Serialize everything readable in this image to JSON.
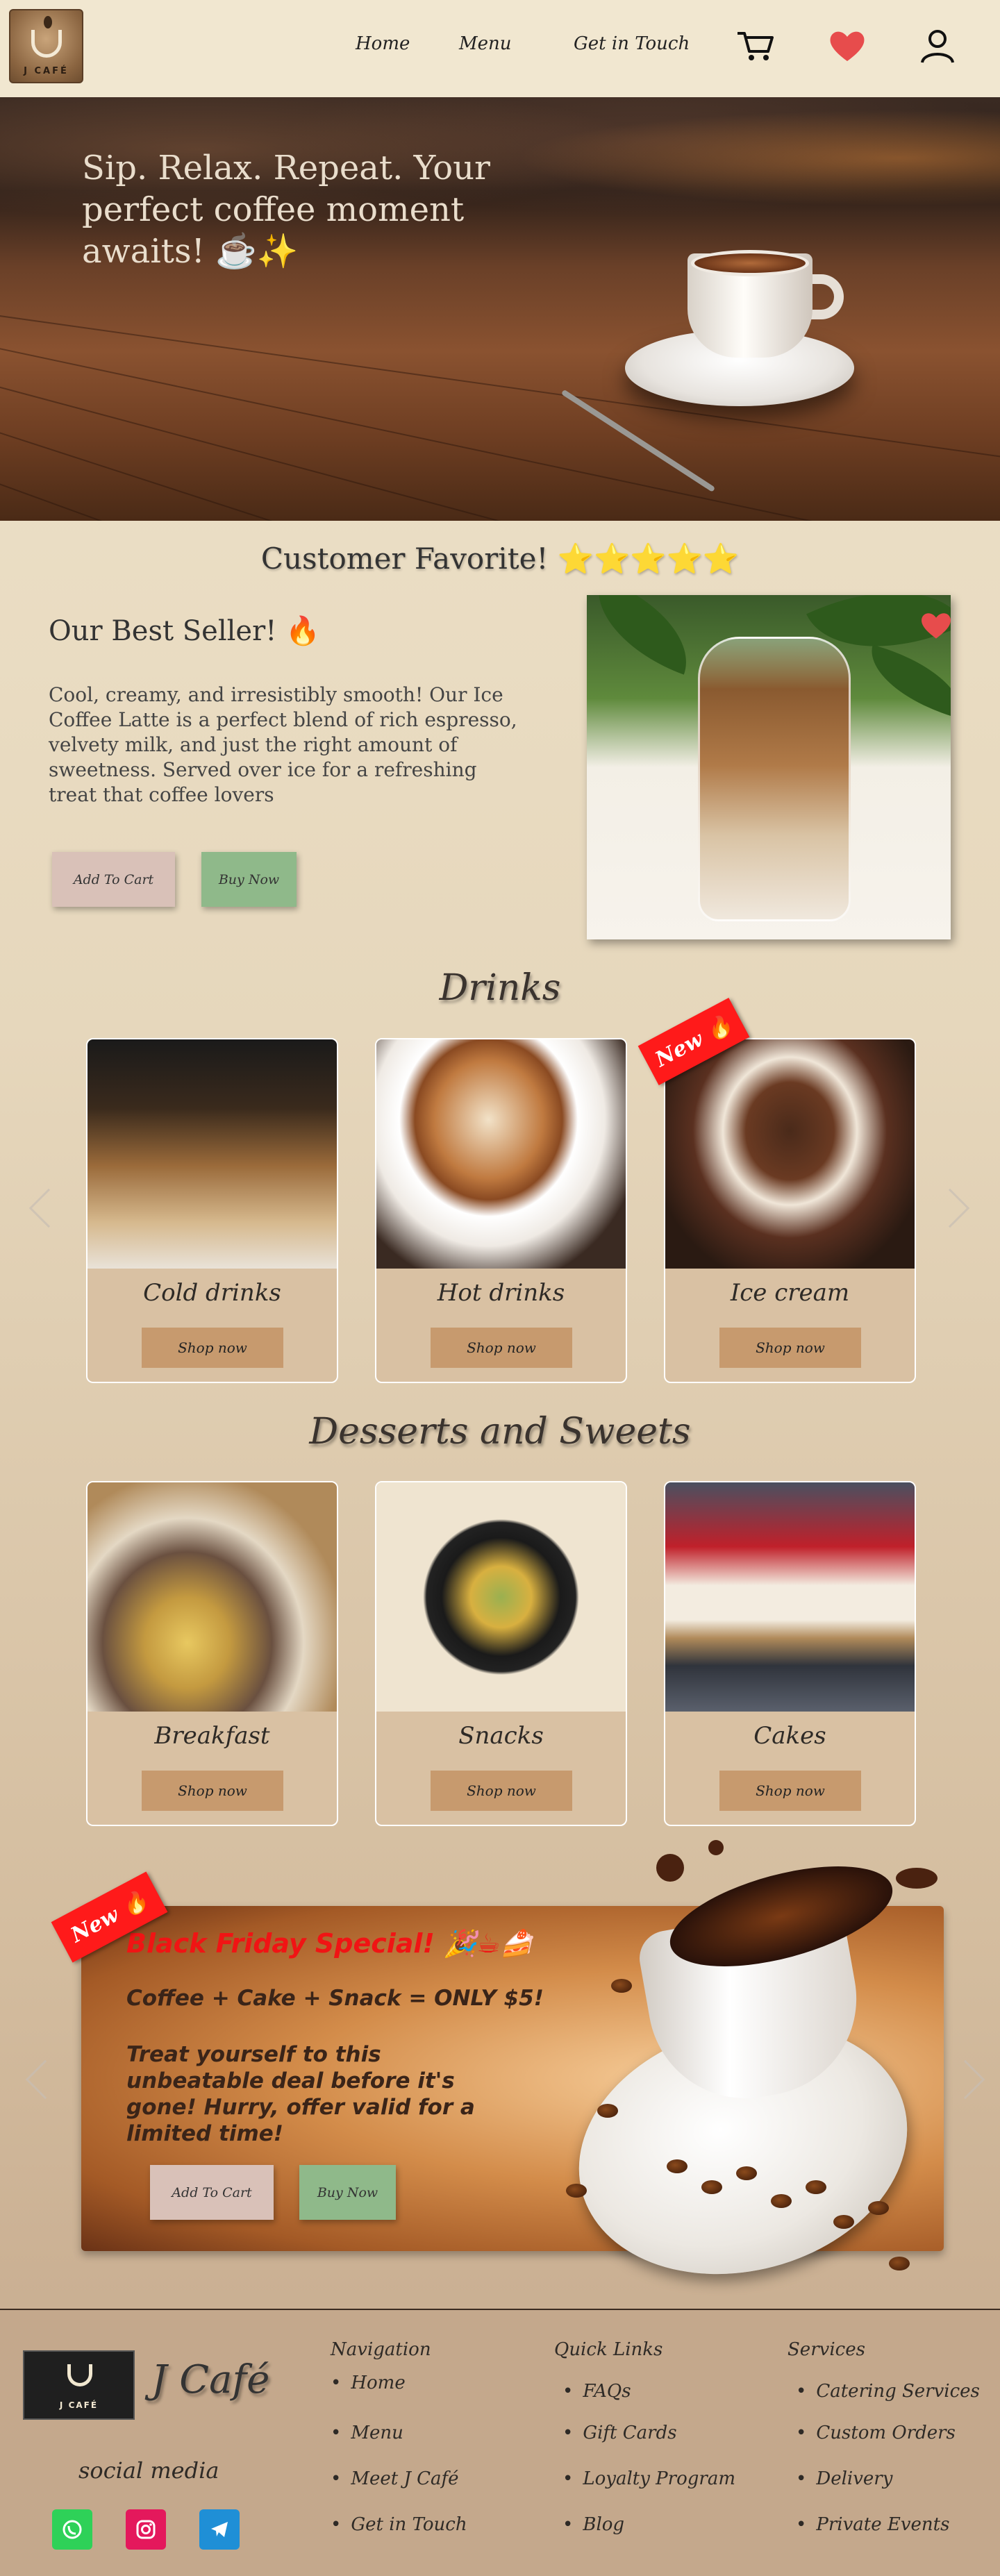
{
  "header": {
    "logo_text": "J CAFÉ",
    "nav": [
      "Home",
      "Menu",
      "Get in Touch"
    ],
    "icons": [
      "cart-icon",
      "heart-icon",
      "user-icon"
    ]
  },
  "hero": {
    "headline": "Sip. Relax. Repeat. Your perfect coffee moment awaits! ☕✨"
  },
  "customer_favorite": {
    "heading": "Customer Favorite! ⭐⭐⭐⭐⭐",
    "title": "Our Best Seller! 🔥",
    "description": "Cool, creamy, and irresistibly smooth! Our Ice Coffee Latte is a perfect blend of rich espresso, velvety milk, and just the right amount of sweetness. Served over ice for a refreshing treat that coffee lovers",
    "add_to_cart": "Add To Cart",
    "buy_now": "Buy Now"
  },
  "drinks": {
    "title": "Drinks",
    "badge": "New 🔥",
    "cards": [
      {
        "label": "Cold drinks",
        "button": "Shop now"
      },
      {
        "label": "Hot drinks",
        "button": "Shop now"
      },
      {
        "label": "Ice cream",
        "button": "Shop now"
      }
    ]
  },
  "desserts": {
    "title": "Desserts and Sweets",
    "cards": [
      {
        "label": "Breakfast",
        "button": "Shop now"
      },
      {
        "label": "Snacks",
        "button": "Shop now"
      },
      {
        "label": "Cakes",
        "button": "Shop now"
      }
    ]
  },
  "promo": {
    "badge": "New 🔥",
    "title": "Black Friday Special! 🎉☕🍰",
    "offer": "Coffee + Cake + Snack = ONLY $5!",
    "text": "Treat yourself to this unbeatable deal before it's gone! Hurry, offer valid for a limited time!",
    "add_to_cart": "Add To Cart",
    "buy_now": "Buy Now"
  },
  "footer": {
    "brand": "J Café",
    "social_label": "social media",
    "social": [
      "whatsapp-icon",
      "instagram-icon",
      "telegram-icon"
    ],
    "columns": [
      {
        "title": "Navigation",
        "items": [
          "Home",
          "Menu",
          "Meet J Café",
          "Get in Touch"
        ]
      },
      {
        "title": "Quick Links",
        "items": [
          "FAQs",
          "Gift Cards",
          "Loyalty Program",
          "Blog"
        ]
      },
      {
        "title": "Services",
        "items": [
          "Catering Services",
          "Custom Orders",
          "Delivery",
          "Private Events"
        ]
      }
    ]
  },
  "colors": {
    "header_bg": "#f1e7d0",
    "accent_red": "#ff1a1a",
    "btn_cart": "#d9c1b8",
    "btn_buy": "#8fb98a",
    "shop_btn": "#c79a6e"
  }
}
